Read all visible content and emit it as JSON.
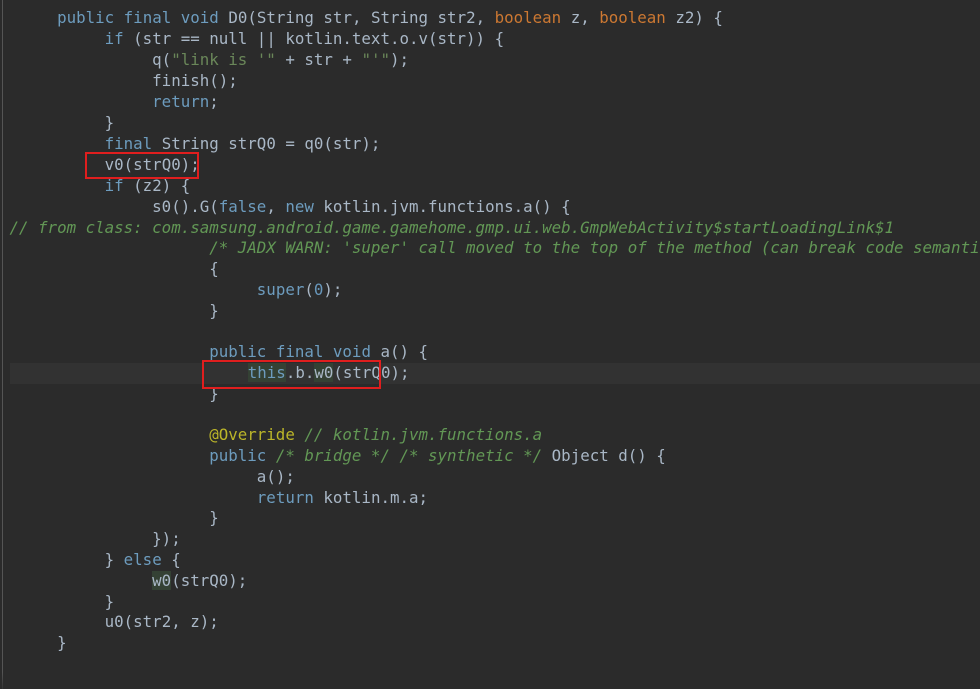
{
  "code_lines": [
    "    public final void D0(String str, String str2, boolean z, boolean z2) {",
    "        if (str == null || kotlin.text.o.v(str)) {",
    "            q(\"link is '\" + str + \"'\");",
    "            finish();",
    "            return;",
    "        }",
    "        final String strQ0 = q0(str);",
    "        v0(strQ0);",
    "        if (z2) {",
    "            s0().G(false, new kotlin.jvm.functions.a() {",
    "// from class: com.samsung.android.game.gamehome.gmp.ui.web.GmpWebActivity$startLoadingLink$1",
    "                /* JADX WARN: 'super' call moved to the top of the method (can break code semantics) */",
    "                {",
    "                    super(0);",
    "                }",
    "",
    "                public final void a() {",
    "                    this.b.w0(strQ0);",
    "                }",
    "",
    "                @Override // kotlin.jvm.functions.a",
    "                public /* bridge */ /* synthetic */ Object d() {",
    "                    a();",
    "                    return kotlin.m.a;",
    "                }",
    "            });",
    "        } else {",
    "            w0(strQ0);",
    "        }",
    "        u0(str2, z);",
    "    }"
  ],
  "tokens": {
    "public": "public",
    "final": "final",
    "void": "void",
    "if": "if",
    "null": "null",
    "return": "return",
    "new": "new",
    "false": "false",
    "super": "super",
    "this": "this",
    "else": "else",
    "override": "@Override",
    "zero": "0",
    "method_d0": "D0(String str, String str2, ",
    "boolean": "boolean",
    "z_param": " z, ",
    "z2_param": " z2) {",
    "if_cond": " (str == null || kotlin.text.o.v(str)) {",
    "q_call_open": "q(",
    "string_link": "\"link is '\"",
    "q_call_mid": " + str + ",
    "string_quote": "\"'\"",
    "q_call_close": ");",
    "finish_call": "finish();",
    "semicolon": ";",
    "close_brace": "}",
    "string_decl": " String strQ0 = q0(str);",
    "v0_call": "v0(strQ0);",
    "if_z2": " (z2) {",
    "s0_call": "s0().G(",
    "comma_space": ", ",
    "functions_a": " kotlin.jvm.functions.a() {",
    "from_class_comment": "// from class: com.samsung.android.game.gamehome.gmp.ui.web.GmpWebActivity$startLoadingLink$1",
    "jadx_warn_comment": "/* JADX WARN: 'super' call moved to the top of the method (can break code semantics) */",
    "open_brace": "{",
    "paren_open": "(",
    "paren_close_semi": ");",
    "method_a": " a() {",
    "dot_b_dot": ".b.",
    "w0_name": "w0",
    "w0_args": "(strQ0);",
    "override_comment": "// kotlin.jvm.functions.a",
    "bridge_comment": "/* bridge */",
    "synthetic_comment": "/* synthetic */",
    "object_d": " Object d() {",
    "a_call": "a();",
    "kotlin_m_a": " kotlin.m.a;",
    "close_lambda": "});",
    "else_open": " {",
    "else_prefix": "} ",
    "u0_call": "u0(str2, z);",
    "space": " "
  },
  "highlights": {
    "box_color": "#e01e1e",
    "boxed_lines": [
      "v0(strQ0);",
      "this.b.w0(strQ0);"
    ]
  },
  "colors": {
    "background": "#2b2b2b",
    "text": "#a9b7c6",
    "keyword": "#6d9cbe",
    "string": "#6a8759",
    "comment": "#629755",
    "annotation": "#bbb529"
  }
}
